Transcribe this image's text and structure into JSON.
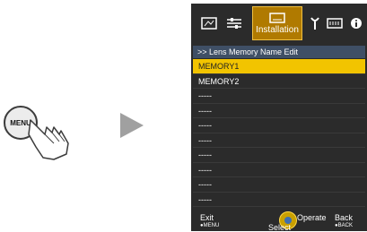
{
  "illustration": {
    "menu_button_label": "MENU"
  },
  "tabs": {
    "active_label": "Installation",
    "icons": [
      "picture-icon",
      "adjust-icon",
      "installation-icon",
      "tool-icon",
      "display-icon",
      "info-icon"
    ]
  },
  "breadcrumb": ">> Lens Memory Name Edit",
  "list": {
    "items": [
      "MEMORY1",
      "MEMORY2",
      "-----",
      "-----",
      "-----",
      "-----",
      "-----",
      "-----",
      "-----",
      "-----"
    ]
  },
  "footer": {
    "exit": "Exit",
    "exit_sub": "●MENU",
    "select": "Select",
    "operate": "Operate",
    "back": "Back",
    "back_sub": "●BACK"
  },
  "colors": {
    "panel_bg": "#2b2b2b",
    "highlight": "#f2c400",
    "breadcrumb_bg": "#3f4f65"
  }
}
